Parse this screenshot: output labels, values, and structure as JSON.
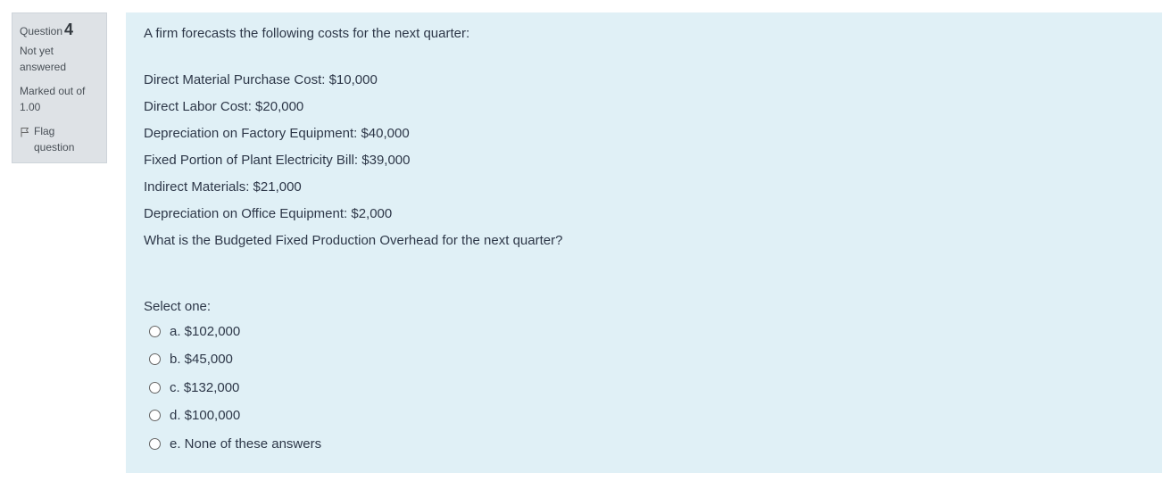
{
  "info": {
    "question_label": "Question",
    "question_number": "4",
    "state": "Not yet answered",
    "grade": "Marked out of 1.00",
    "flag_label": "Flag question",
    "flag_icon": "flag-outline-icon"
  },
  "question": {
    "intro": "A firm forecasts the following costs for the next quarter:",
    "lines": [
      "Direct Material Purchase Cost: $10,000",
      "Direct Labor Cost: $20,000",
      "Depreciation on Factory Equipment: $40,000",
      "Fixed Portion of Plant Electricity Bill: $39,000",
      "Indirect Materials: $21,000",
      "Depreciation on Office Equipment: $2,000"
    ],
    "ask": "What is the Budgeted Fixed Production Overhead for the next quarter?",
    "prompt": "Select one:",
    "answers": [
      "a. $102,000",
      "b. $45,000",
      "c. $132,000",
      "d. $100,000",
      "e. None of these answers"
    ]
  },
  "colors": {
    "info_bg": "#dee2e6",
    "content_bg": "#e0f0f6"
  }
}
